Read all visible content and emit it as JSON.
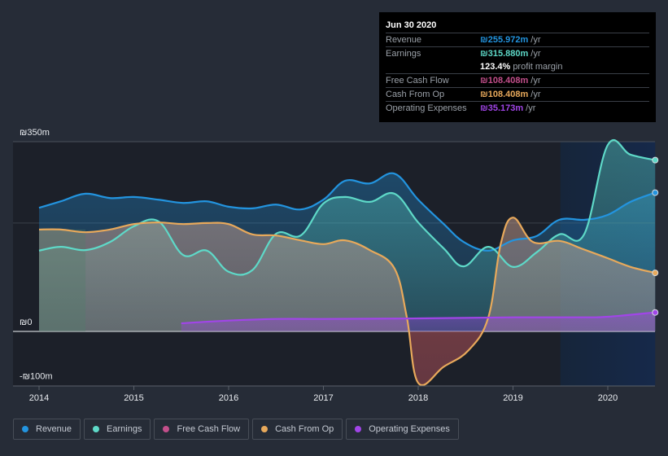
{
  "tooltip": {
    "date": "Jun 30 2020",
    "rows": [
      {
        "label": "Revenue",
        "value": "₪255.972m",
        "unit": "/yr",
        "color": "#2394df"
      },
      {
        "label": "Earnings",
        "value": "₪315.880m",
        "unit": "/yr",
        "color": "#5ed9c8"
      },
      {
        "label": "",
        "value": "123.4%",
        "unit": "profit margin",
        "color": "#ffffff"
      },
      {
        "label": "Free Cash Flow",
        "value": "₪108.408m",
        "unit": "/yr",
        "color": "#c34f8b"
      },
      {
        "label": "Cash From Op",
        "value": "₪108.408m",
        "unit": "/yr",
        "color": "#e8a95b"
      },
      {
        "label": "Operating Expenses",
        "value": "₪35.173m",
        "unit": "/yr",
        "color": "#a145e8"
      }
    ]
  },
  "legend": [
    {
      "label": "Revenue",
      "color": "#2394df"
    },
    {
      "label": "Earnings",
      "color": "#5ed9c8"
    },
    {
      "label": "Free Cash Flow",
      "color": "#c34f8b"
    },
    {
      "label": "Cash From Op",
      "color": "#e8a95b"
    },
    {
      "label": "Operating Expenses",
      "color": "#a145e8"
    }
  ],
  "chart_data": {
    "type": "area",
    "title": "",
    "xlabel": "",
    "ylabel": "",
    "currency": "₪",
    "ylim": [
      -100,
      350
    ],
    "y_tick_labels": [
      "₪350m",
      "₪0",
      "-₪100m"
    ],
    "y_ticks": [
      350,
      0,
      -100
    ],
    "xlim": [
      2014,
      2020.5
    ],
    "x_tick_labels": [
      "2014",
      "2015",
      "2016",
      "2017",
      "2018",
      "2019",
      "2020"
    ],
    "x_ticks": [
      2014,
      2015,
      2016,
      2017,
      2018,
      2019,
      2020
    ],
    "highlight_start": 2019.5,
    "grid": true,
    "legend_position": "bottom",
    "series": [
      {
        "name": "Revenue",
        "color": "#2394df",
        "x": [
          2014,
          2014.23,
          2014.49,
          2014.75,
          2015,
          2015.26,
          2015.52,
          2015.77,
          2016,
          2016.25,
          2016.5,
          2016.76,
          2017,
          2017.23,
          2017.49,
          2017.75,
          2018,
          2018.27,
          2018.48,
          2018.74,
          2019,
          2019.25,
          2019.49,
          2019.76,
          2020,
          2020.24,
          2020.5
        ],
        "values": [
          228,
          240,
          254,
          246,
          248,
          243,
          237,
          240,
          230,
          227,
          234,
          225,
          243,
          278,
          273,
          291,
          243,
          198,
          165,
          149,
          168,
          176,
          206,
          206,
          215,
          239,
          256
        ]
      },
      {
        "name": "Earnings",
        "color": "#5ed9c8",
        "x": [
          2014,
          2014.23,
          2014.49,
          2014.75,
          2015,
          2015.26,
          2015.52,
          2015.77,
          2016,
          2016.25,
          2016.5,
          2016.76,
          2017,
          2017.23,
          2017.49,
          2017.75,
          2018,
          2018.27,
          2018.48,
          2018.74,
          2019,
          2019.25,
          2019.49,
          2019.75,
          2020,
          2020.24,
          2020.5
        ],
        "values": [
          149,
          156,
          150,
          165,
          194,
          203,
          141,
          149,
          110,
          113,
          180,
          177,
          236,
          248,
          239,
          254,
          201,
          153,
          120,
          156,
          119,
          146,
          179,
          179,
          344,
          326,
          316
        ]
      },
      {
        "name": "Free Cash Flow",
        "color": "#c34f8b",
        "x": [
          2014,
          2014.23,
          2014.49,
          2014.75,
          2015,
          2015.26,
          2015.52,
          2015.77,
          2016,
          2016.25,
          2016.5,
          2016.76,
          2017,
          2017.23,
          2017.49,
          2017.75,
          2017.88,
          2018,
          2018.27,
          2018.53,
          2018.74,
          2018.87,
          2019,
          2019.21,
          2019.49,
          2019.72,
          2020,
          2020.24,
          2020.5
        ],
        "values": [
          188,
          188,
          183,
          188,
          198,
          201,
          198,
          200,
          198,
          179,
          177,
          168,
          161,
          168,
          150,
          116,
          26,
          -95,
          -65,
          -35,
          26,
          161,
          210,
          165,
          167,
          153,
          135,
          119,
          108
        ]
      },
      {
        "name": "Cash From Op",
        "color": "#e8a95b",
        "x": [
          2014,
          2014.23,
          2014.49,
          2014.75,
          2015,
          2015.26,
          2015.52,
          2015.77,
          2016,
          2016.25,
          2016.5,
          2016.76,
          2017,
          2017.23,
          2017.49,
          2017.75,
          2017.88,
          2018,
          2018.27,
          2018.53,
          2018.74,
          2018.87,
          2019,
          2019.21,
          2019.49,
          2019.72,
          2020,
          2020.24,
          2020.5
        ],
        "values": [
          188,
          188,
          183,
          188,
          198,
          201,
          198,
          200,
          198,
          179,
          177,
          168,
          161,
          168,
          150,
          116,
          26,
          -95,
          -65,
          -35,
          26,
          161,
          210,
          165,
          167,
          153,
          135,
          119,
          108
        ]
      },
      {
        "name": "Operating Expenses",
        "color": "#a145e8",
        "x": [
          2015.5,
          2016,
          2016.5,
          2017,
          2018,
          2019,
          2019.75,
          2020,
          2020.5
        ],
        "values": [
          15,
          20,
          23,
          23,
          24,
          26,
          26,
          27,
          35
        ]
      }
    ]
  }
}
